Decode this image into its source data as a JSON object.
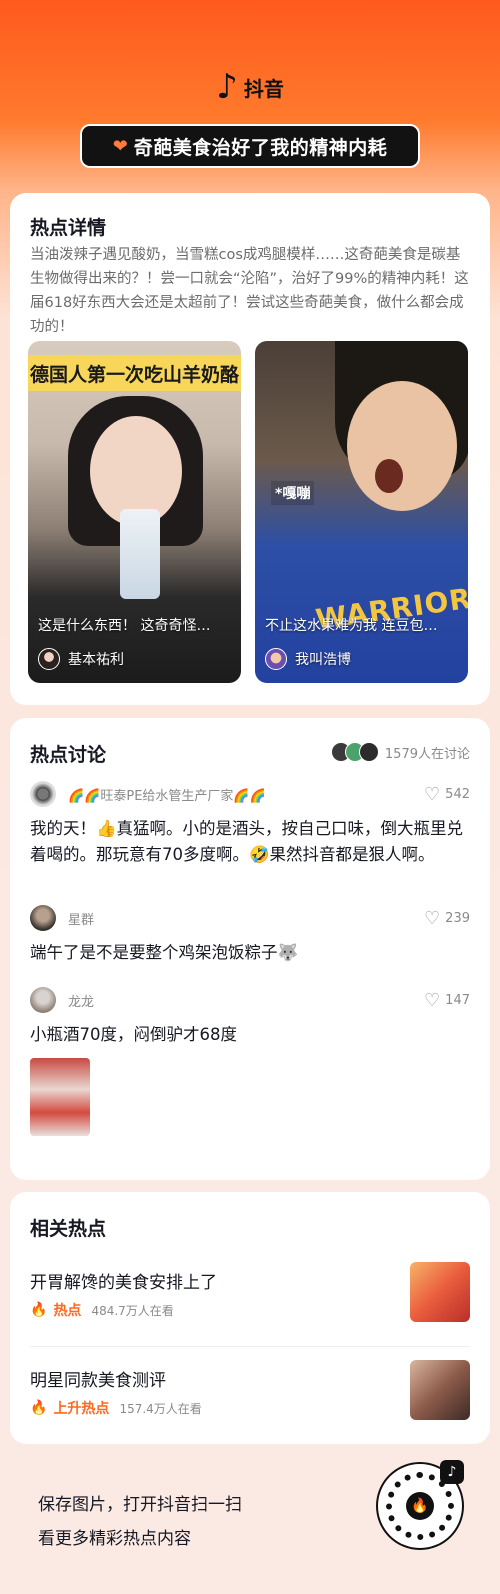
{
  "header": {
    "logo_glyph": "♪",
    "app_name": "抖音",
    "topic_title": "奇葩美食治好了我的精神内耗"
  },
  "detail": {
    "title": "热点详情",
    "description": "当油泼辣子遇见酸奶，当雪糕cos成鸡腿模样……这奇葩美食是碳基生物做得出来的？！尝一口就会“沦陷”，治好了99%的精神内耗！这届618好东西大会还是太超前了！尝试这些奇葩美食，做什么都会成功的！",
    "videos": [
      {
        "banner": "德国人第一次吃山羊奶酪",
        "caption": "这是什么东西！ 这奇奇怪…",
        "author": "基本祐利"
      },
      {
        "tag": "*嘎嘣",
        "shirt_text": "WARRIORS",
        "caption": "不止这水果难为我 连豆包…",
        "author": "我叫浩博"
      }
    ]
  },
  "discussion": {
    "title": "热点讨论",
    "participants": "1579人在讨论",
    "comments": [
      {
        "user": "🌈🌈旺泰PE给水管生产厂家🌈🌈",
        "likes": "542",
        "text": "我的天！👍真猛啊。小的是酒头，按自己口味，倒大瓶里兑着喝的。那玩意有70多度啊。🤣果然抖音都是狠人啊。"
      },
      {
        "user": "星群",
        "likes": "239",
        "text": "端午了是不是要整个鸡架泡饭粽子🐺"
      },
      {
        "user": "龙龙",
        "likes": "147",
        "text": "小瓶酒70度，闷倒驴才68度"
      }
    ]
  },
  "related": {
    "title": "相关热点",
    "items": [
      {
        "title": "开胃解馋的美食安排上了",
        "badge": "热点",
        "views": "484.7万人在看"
      },
      {
        "title": "明星同款美食测评",
        "badge": "上升热点",
        "views": "157.4万人在看"
      }
    ]
  },
  "footer": {
    "line1": "保存图片，打开抖音扫一扫",
    "line2": "看更多精彩热点内容"
  }
}
